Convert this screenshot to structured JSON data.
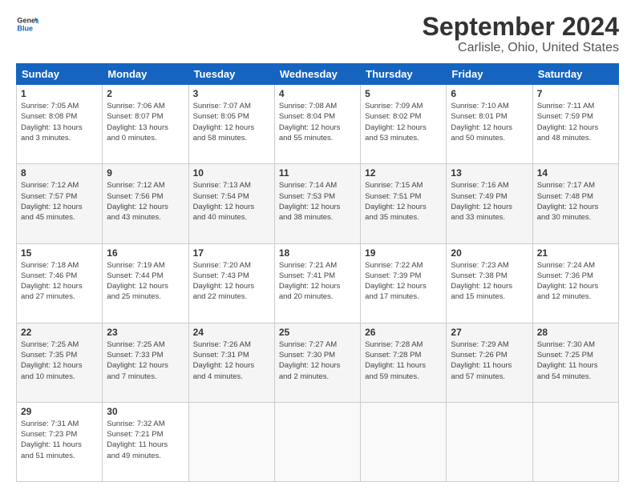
{
  "header": {
    "logo_line1": "General",
    "logo_line2": "Blue",
    "title": "September 2024",
    "subtitle": "Carlisle, Ohio, United States"
  },
  "weekdays": [
    "Sunday",
    "Monday",
    "Tuesday",
    "Wednesday",
    "Thursday",
    "Friday",
    "Saturday"
  ],
  "weeks": [
    [
      {
        "day": "1",
        "info": "Sunrise: 7:05 AM\nSunset: 8:08 PM\nDaylight: 13 hours\nand 3 minutes."
      },
      {
        "day": "2",
        "info": "Sunrise: 7:06 AM\nSunset: 8:07 PM\nDaylight: 13 hours\nand 0 minutes."
      },
      {
        "day": "3",
        "info": "Sunrise: 7:07 AM\nSunset: 8:05 PM\nDaylight: 12 hours\nand 58 minutes."
      },
      {
        "day": "4",
        "info": "Sunrise: 7:08 AM\nSunset: 8:04 PM\nDaylight: 12 hours\nand 55 minutes."
      },
      {
        "day": "5",
        "info": "Sunrise: 7:09 AM\nSunset: 8:02 PM\nDaylight: 12 hours\nand 53 minutes."
      },
      {
        "day": "6",
        "info": "Sunrise: 7:10 AM\nSunset: 8:01 PM\nDaylight: 12 hours\nand 50 minutes."
      },
      {
        "day": "7",
        "info": "Sunrise: 7:11 AM\nSunset: 7:59 PM\nDaylight: 12 hours\nand 48 minutes."
      }
    ],
    [
      {
        "day": "8",
        "info": "Sunrise: 7:12 AM\nSunset: 7:57 PM\nDaylight: 12 hours\nand 45 minutes."
      },
      {
        "day": "9",
        "info": "Sunrise: 7:12 AM\nSunset: 7:56 PM\nDaylight: 12 hours\nand 43 minutes."
      },
      {
        "day": "10",
        "info": "Sunrise: 7:13 AM\nSunset: 7:54 PM\nDaylight: 12 hours\nand 40 minutes."
      },
      {
        "day": "11",
        "info": "Sunrise: 7:14 AM\nSunset: 7:53 PM\nDaylight: 12 hours\nand 38 minutes."
      },
      {
        "day": "12",
        "info": "Sunrise: 7:15 AM\nSunset: 7:51 PM\nDaylight: 12 hours\nand 35 minutes."
      },
      {
        "day": "13",
        "info": "Sunrise: 7:16 AM\nSunset: 7:49 PM\nDaylight: 12 hours\nand 33 minutes."
      },
      {
        "day": "14",
        "info": "Sunrise: 7:17 AM\nSunset: 7:48 PM\nDaylight: 12 hours\nand 30 minutes."
      }
    ],
    [
      {
        "day": "15",
        "info": "Sunrise: 7:18 AM\nSunset: 7:46 PM\nDaylight: 12 hours\nand 27 minutes."
      },
      {
        "day": "16",
        "info": "Sunrise: 7:19 AM\nSunset: 7:44 PM\nDaylight: 12 hours\nand 25 minutes."
      },
      {
        "day": "17",
        "info": "Sunrise: 7:20 AM\nSunset: 7:43 PM\nDaylight: 12 hours\nand 22 minutes."
      },
      {
        "day": "18",
        "info": "Sunrise: 7:21 AM\nSunset: 7:41 PM\nDaylight: 12 hours\nand 20 minutes."
      },
      {
        "day": "19",
        "info": "Sunrise: 7:22 AM\nSunset: 7:39 PM\nDaylight: 12 hours\nand 17 minutes."
      },
      {
        "day": "20",
        "info": "Sunrise: 7:23 AM\nSunset: 7:38 PM\nDaylight: 12 hours\nand 15 minutes."
      },
      {
        "day": "21",
        "info": "Sunrise: 7:24 AM\nSunset: 7:36 PM\nDaylight: 12 hours\nand 12 minutes."
      }
    ],
    [
      {
        "day": "22",
        "info": "Sunrise: 7:25 AM\nSunset: 7:35 PM\nDaylight: 12 hours\nand 10 minutes."
      },
      {
        "day": "23",
        "info": "Sunrise: 7:25 AM\nSunset: 7:33 PM\nDaylight: 12 hours\nand 7 minutes."
      },
      {
        "day": "24",
        "info": "Sunrise: 7:26 AM\nSunset: 7:31 PM\nDaylight: 12 hours\nand 4 minutes."
      },
      {
        "day": "25",
        "info": "Sunrise: 7:27 AM\nSunset: 7:30 PM\nDaylight: 12 hours\nand 2 minutes."
      },
      {
        "day": "26",
        "info": "Sunrise: 7:28 AM\nSunset: 7:28 PM\nDaylight: 11 hours\nand 59 minutes."
      },
      {
        "day": "27",
        "info": "Sunrise: 7:29 AM\nSunset: 7:26 PM\nDaylight: 11 hours\nand 57 minutes."
      },
      {
        "day": "28",
        "info": "Sunrise: 7:30 AM\nSunset: 7:25 PM\nDaylight: 11 hours\nand 54 minutes."
      }
    ],
    [
      {
        "day": "29",
        "info": "Sunrise: 7:31 AM\nSunset: 7:23 PM\nDaylight: 11 hours\nand 51 minutes."
      },
      {
        "day": "30",
        "info": "Sunrise: 7:32 AM\nSunset: 7:21 PM\nDaylight: 11 hours\nand 49 minutes."
      },
      {
        "day": "",
        "info": ""
      },
      {
        "day": "",
        "info": ""
      },
      {
        "day": "",
        "info": ""
      },
      {
        "day": "",
        "info": ""
      },
      {
        "day": "",
        "info": ""
      }
    ]
  ]
}
